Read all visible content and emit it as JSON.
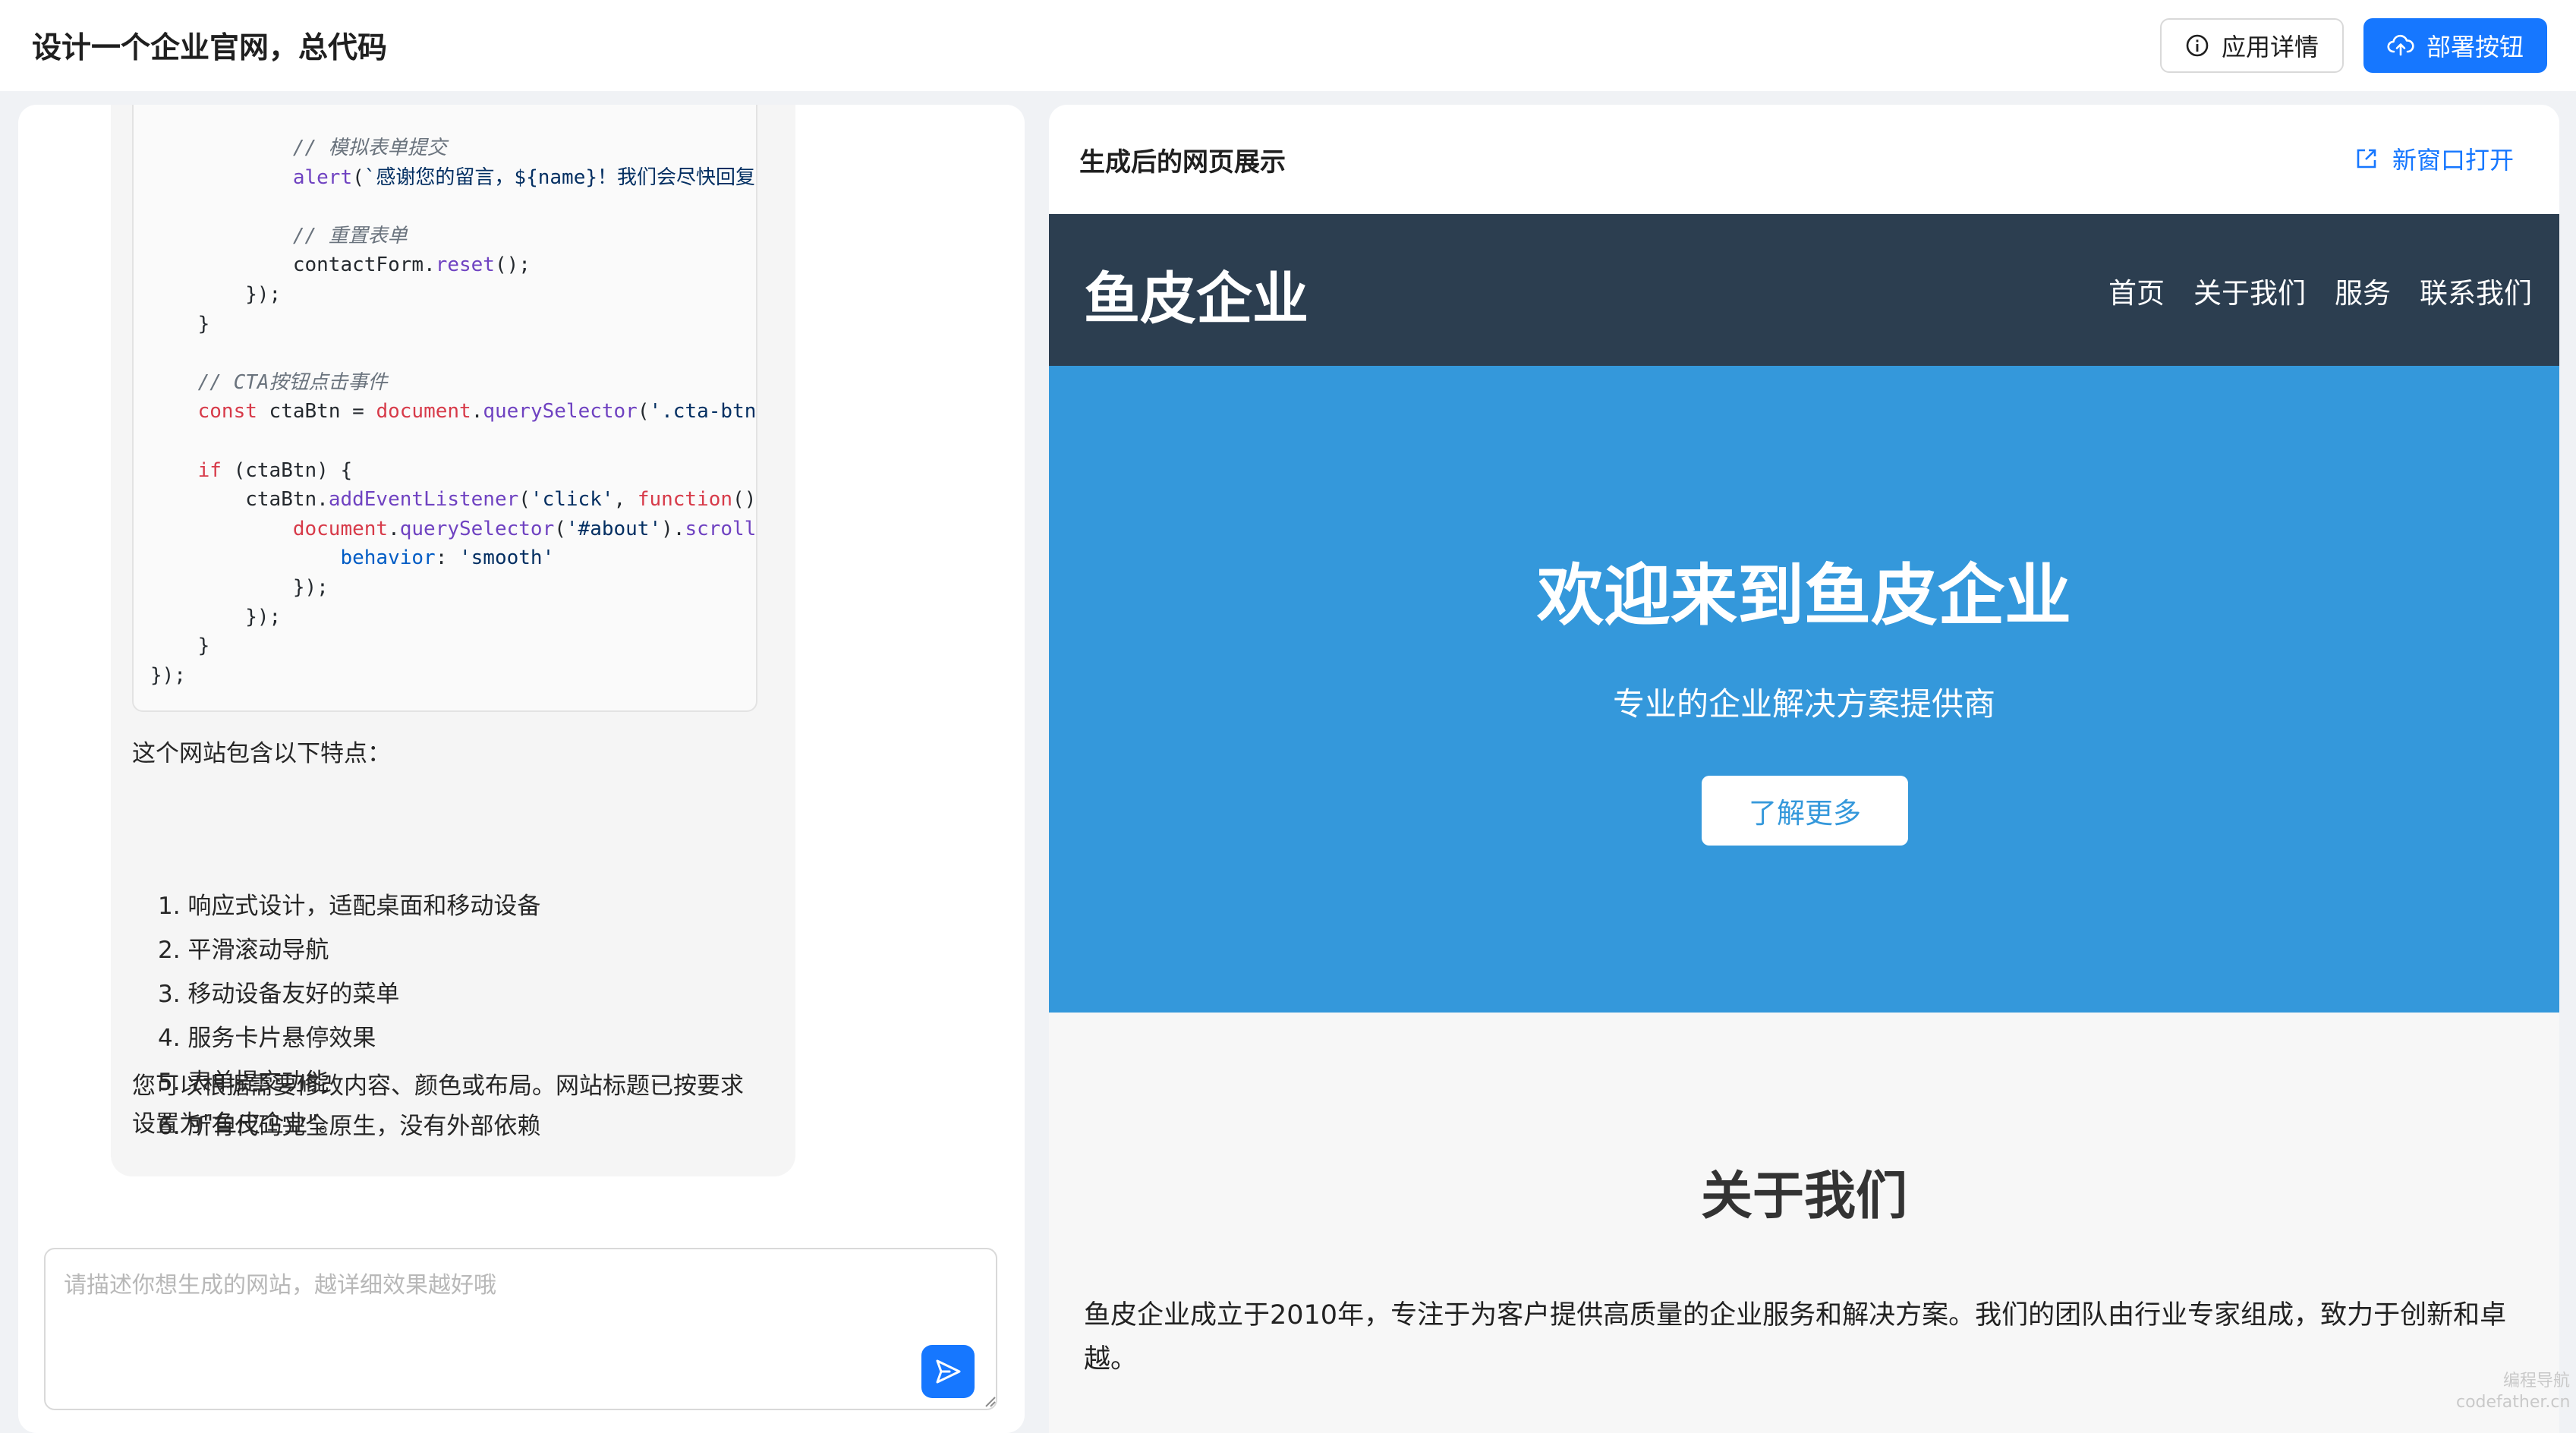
{
  "header": {
    "title": "设计一个企业官网，总代码",
    "detail_label": "应用详情",
    "deploy_label": "部署按钮"
  },
  "chat": {
    "code_lines": [
      {
        "indent": "            ",
        "parts": [
          {
            "c": "cm",
            "t": "// 模拟表单提交"
          }
        ]
      },
      {
        "indent": "            ",
        "parts": [
          {
            "c": "fn",
            "t": "alert"
          },
          {
            "c": "",
            "t": "("
          },
          {
            "c": "st",
            "t": "`感谢您的留言，${name}！我们会尽快回复您。`"
          },
          {
            "c": "",
            "t": ");"
          }
        ]
      },
      {
        "indent": "",
        "parts": []
      },
      {
        "indent": "            ",
        "parts": [
          {
            "c": "cm",
            "t": "// 重置表单"
          }
        ]
      },
      {
        "indent": "            ",
        "parts": [
          {
            "c": "",
            "t": "contactForm."
          },
          {
            "c": "fn",
            "t": "reset"
          },
          {
            "c": "",
            "t": "();"
          }
        ]
      },
      {
        "indent": "        ",
        "parts": [
          {
            "c": "",
            "t": "});"
          }
        ]
      },
      {
        "indent": "    ",
        "parts": [
          {
            "c": "",
            "t": "}"
          }
        ]
      },
      {
        "indent": "",
        "parts": []
      },
      {
        "indent": "    ",
        "parts": [
          {
            "c": "cm",
            "t": "// CTA按钮点击事件"
          }
        ]
      },
      {
        "indent": "    ",
        "parts": [
          {
            "c": "kw",
            "t": "const"
          },
          {
            "c": "",
            "t": " ctaBtn = "
          },
          {
            "c": "kw",
            "t": "document"
          },
          {
            "c": "",
            "t": "."
          },
          {
            "c": "fn",
            "t": "querySelector"
          },
          {
            "c": "",
            "t": "("
          },
          {
            "c": "st",
            "t": "'.cta-btn'"
          },
          {
            "c": "",
            "t": ");"
          }
        ]
      },
      {
        "indent": "",
        "parts": []
      },
      {
        "indent": "    ",
        "parts": [
          {
            "c": "kw",
            "t": "if"
          },
          {
            "c": "",
            "t": " (ctaBtn) {"
          }
        ]
      },
      {
        "indent": "        ",
        "parts": [
          {
            "c": "",
            "t": "ctaBtn."
          },
          {
            "c": "fn",
            "t": "addEventListener"
          },
          {
            "c": "",
            "t": "("
          },
          {
            "c": "st",
            "t": "'click'"
          },
          {
            "c": "",
            "t": ", "
          },
          {
            "c": "kw",
            "t": "function"
          },
          {
            "c": "",
            "t": "() {"
          }
        ]
      },
      {
        "indent": "            ",
        "parts": [
          {
            "c": "kw",
            "t": "document"
          },
          {
            "c": "",
            "t": "."
          },
          {
            "c": "fn",
            "t": "querySelector"
          },
          {
            "c": "",
            "t": "("
          },
          {
            "c": "st",
            "t": "'#about'"
          },
          {
            "c": "",
            "t": ")."
          },
          {
            "c": "fn",
            "t": "scrollIntoView"
          },
          {
            "c": "",
            "t": "({"
          }
        ]
      },
      {
        "indent": "                ",
        "parts": [
          {
            "c": "ob",
            "t": "behavior"
          },
          {
            "c": "",
            "t": ": "
          },
          {
            "c": "st",
            "t": "'smooth'"
          }
        ]
      },
      {
        "indent": "            ",
        "parts": [
          {
            "c": "",
            "t": "});"
          }
        ]
      },
      {
        "indent": "        ",
        "parts": [
          {
            "c": "",
            "t": "});"
          }
        ]
      },
      {
        "indent": "    ",
        "parts": [
          {
            "c": "",
            "t": "}"
          }
        ]
      },
      {
        "indent": "",
        "parts": [
          {
            "c": "",
            "t": "});"
          }
        ]
      }
    ],
    "features_intro": "这个网站包含以下特点：",
    "features": [
      "1. 响应式设计，适配桌面和移动设备",
      "2. 平滑滚动导航",
      "3. 移动设备友好的菜单",
      "4. 服务卡片悬停效果",
      "5. 表单提交功能",
      "6. 所有代码完全原生，没有外部依赖"
    ],
    "closing_line1": "您可以根据需要修改内容、颜色或布局。网站标题已按要求",
    "closing_line2": "设置为\"鱼皮企业\"。",
    "input_placeholder": "请描述你想生成的网站，越详细效果越好哦"
  },
  "preview": {
    "title": "生成后的网页展示",
    "open_label": "新窗口打开",
    "site": {
      "logo": "鱼皮企业",
      "menu": [
        "首页",
        "关于我们",
        "服务",
        "联系我们"
      ],
      "hero_title": "欢迎来到鱼皮企业",
      "hero_subtitle": "专业的企业解决方案提供商",
      "hero_button": "了解更多",
      "about_title": "关于我们",
      "about_text": "鱼皮企业成立于2010年，专注于为客户提供高质量的企业服务和解决方案。我们的团队由行业专家组成，致力于创新和卓越。"
    },
    "colors": {
      "nav_bg": "#2c3e50",
      "hero_bg": "#3498db",
      "primary": "#1677ff"
    }
  },
  "watermark": {
    "line1": "编程导航",
    "line2": "codefather.cn"
  }
}
